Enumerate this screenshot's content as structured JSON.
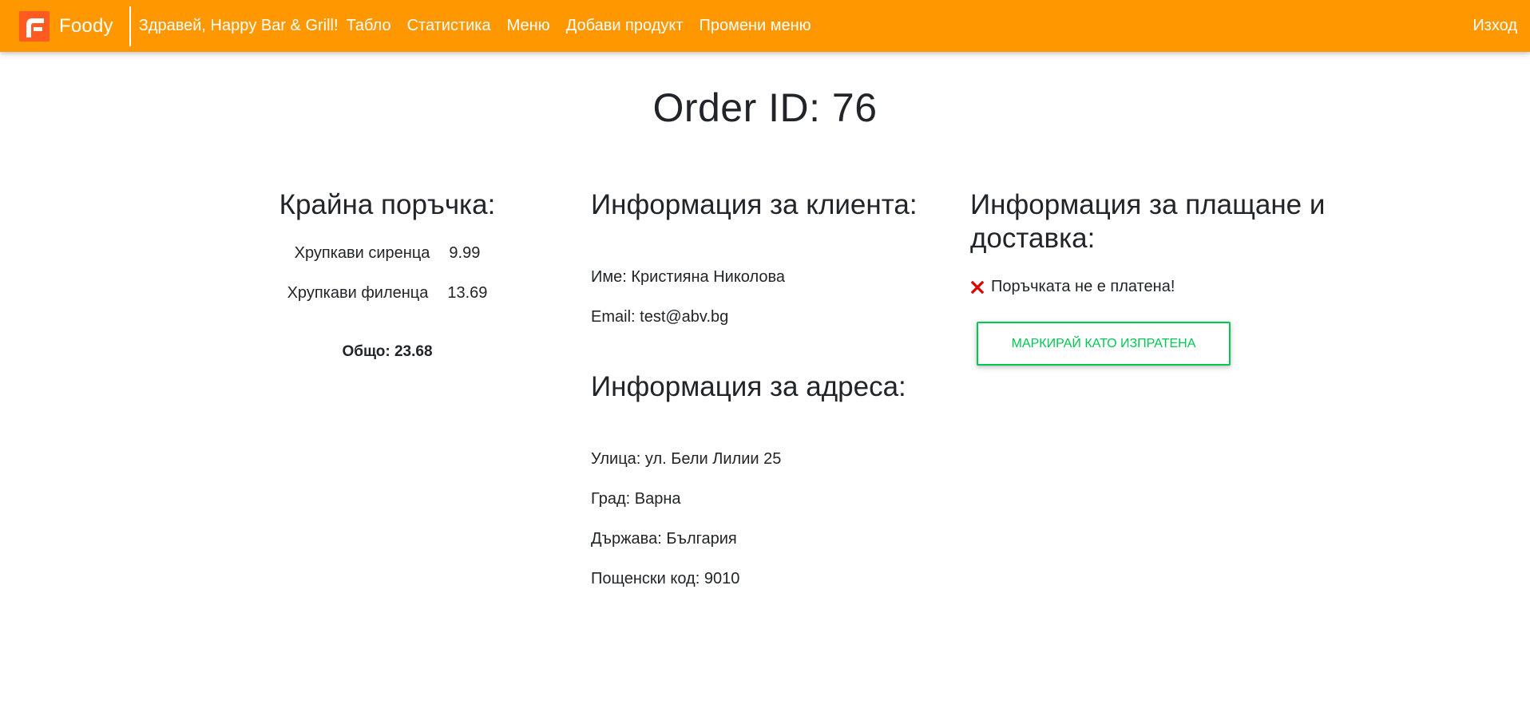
{
  "colors": {
    "navbar": "#ff9800",
    "logo": "#ff5a1f",
    "success": "#00c851",
    "error": "#e00000"
  },
  "navbar": {
    "brand": "Foody",
    "brand_icon": "foody-logo-icon",
    "greeting": "Здравей, Happy Bar & Grill!",
    "links": [
      "Табло",
      "Статистика",
      "Меню",
      "Добави продукт",
      "Промени меню"
    ],
    "logout": "Изход"
  },
  "page": {
    "title": "Order ID: 76"
  },
  "order": {
    "title": "Крайна поръчка:",
    "items": [
      {
        "name": "Хрупкави сиренца",
        "price": "9.99"
      },
      {
        "name": "Хрупкави филенца",
        "price": "13.69"
      }
    ],
    "total_label": "Общо:",
    "total_value": "23.68"
  },
  "client": {
    "title": "Информация за клиента:",
    "name_label": "Име:",
    "name_value": "Кристияна Николова",
    "email_label": "Email:",
    "email_value": "test@abv.bg"
  },
  "address": {
    "title": "Информация за адреса:",
    "street_label": "Улица:",
    "street_value": "ул. Бели Лилии 25",
    "city_label": "Град:",
    "city_value": "Варна",
    "country_label": "Държава:",
    "country_value": "България",
    "postal_label": "Пощенски код:",
    "postal_value": "9010"
  },
  "payment": {
    "title": "Информация за плащане и доставка:",
    "status_icon": "cross-icon",
    "status_text": "Поръчката не е платена!",
    "mark_sent_button": "Маркирай като изпратена"
  }
}
